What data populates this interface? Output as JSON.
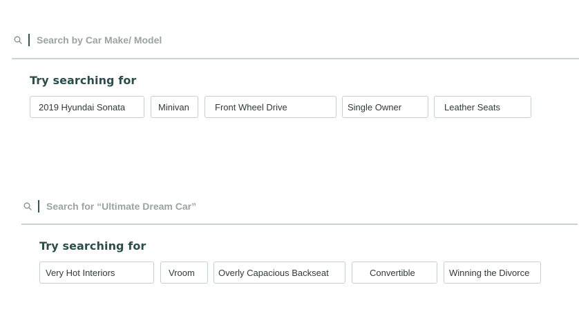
{
  "search_1": {
    "icon": "search-icon",
    "placeholder": "Search by Car Make/ Model",
    "heading": "Try searching for",
    "chips": [
      "2019 Hyundai Sonata",
      "Minivan",
      "Front Wheel Drive",
      "Single Owner",
      "Leather Seats"
    ]
  },
  "search_2": {
    "icon": "search-icon",
    "placeholder": "Search for “Ultimate Dream Car”",
    "heading": "Try searching for",
    "chips": [
      "Very Hot Interiors",
      "Vroom",
      "Overly Capacious Backseat",
      "Convertible",
      "Winning the Divorce"
    ]
  },
  "colors": {
    "heading": "#2b4e4d",
    "chip_border": "#c6cfcf",
    "divider": "#c8d3d3",
    "placeholder": "#9ba3a4",
    "caret": "#2e5752"
  }
}
